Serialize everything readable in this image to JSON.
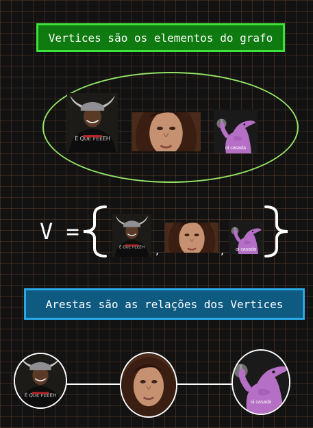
{
  "title": "Vertices são os elementos do grafo",
  "subtitle": "Arestas são as relações dos Vertices",
  "set_label": "V =",
  "separator": ",",
  "vertices": [
    {
      "icon": "man-viking-helmet-photo",
      "caption": ""
    },
    {
      "icon": "woman-portrait-photo",
      "caption": ""
    },
    {
      "icon": "purple-dolphin-meme",
      "caption": "oi casada"
    }
  ],
  "colors": {
    "background": "#121212",
    "grid": "#784e32",
    "title_fill": "#0f7a10",
    "title_border": "#3de33a",
    "subtitle_fill": "#0e5a80",
    "subtitle_border": "#29a8e8",
    "ellipse": "#93e265",
    "lines": "#ffffff"
  }
}
